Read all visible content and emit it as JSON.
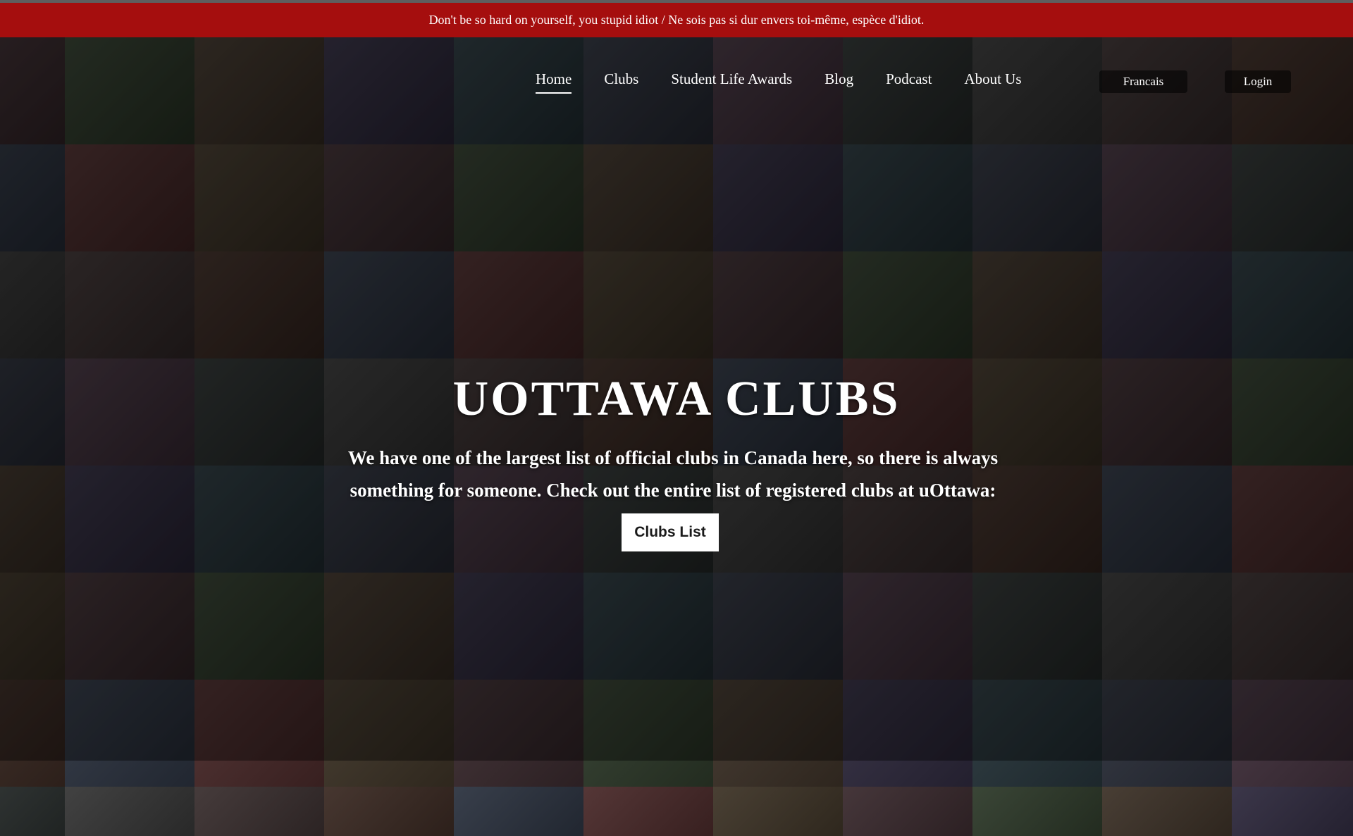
{
  "banner": {
    "text": "Don't be so hard on yourself, you stupid idiot / Ne sois pas si dur envers toi-même, espèce d'idiot."
  },
  "nav": {
    "items": [
      {
        "label": "Home",
        "active": true
      },
      {
        "label": "Clubs",
        "active": false
      },
      {
        "label": "Student Life Awards",
        "active": false
      },
      {
        "label": "Blog",
        "active": false
      },
      {
        "label": "Podcast",
        "active": false
      },
      {
        "label": "About Us",
        "active": false
      }
    ],
    "language_label": "Francais",
    "login_label": "Login"
  },
  "hero": {
    "title": "UOTTAWA CLUBS",
    "text": "We have one of the largest list of official clubs in Canada here, so there is always something for someone. Check out the entire list of registered clubs at uOttawa:",
    "button_label": "Clubs List"
  },
  "colors": {
    "banner": "#a50e0e",
    "tiles": [
      "#3a2a2e",
      "#2b2f3a",
      "#3b2a23",
      "#2e3a2a",
      "#41303c",
      "#2c3340",
      "#3d3228",
      "#2a2f2e",
      "#4a2a2a",
      "#2f2a3e",
      "#363636",
      "#3e3427",
      "#26343a",
      "#3a2f2f"
    ]
  }
}
